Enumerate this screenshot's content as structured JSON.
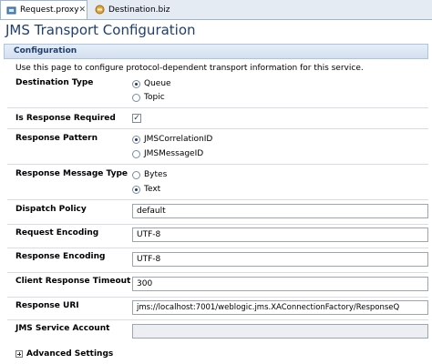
{
  "tabs": [
    {
      "label": "Request.proxy",
      "close": "✕"
    },
    {
      "label": "Destination.biz"
    }
  ],
  "page_title": "JMS Transport Configuration",
  "section_header": "Configuration",
  "description": "Use this page to configure protocol-dependent transport information for this service.",
  "labels": {
    "destination_type": "Destination Type",
    "is_response_required": "Is Response Required",
    "response_pattern": "Response Pattern",
    "response_message_type": "Response Message Type",
    "dispatch_policy": "Dispatch Policy",
    "request_encoding": "Request Encoding",
    "response_encoding": "Response Encoding",
    "client_response_timeout": "Client Response Timeout",
    "response_uri": "Response URI",
    "jms_service_account": "JMS Service Account"
  },
  "destination_type_options": [
    {
      "label": "Queue",
      "selected": true
    },
    {
      "label": "Topic",
      "selected": false
    }
  ],
  "is_response_required": true,
  "response_pattern_options": [
    {
      "label": "JMSCorrelationID",
      "selected": true
    },
    {
      "label": "JMSMessageID",
      "selected": false
    }
  ],
  "response_message_type_options": [
    {
      "label": "Bytes",
      "selected": false
    },
    {
      "label": "Text",
      "selected": true
    }
  ],
  "values": {
    "dispatch_policy": "default",
    "request_encoding": "UTF-8",
    "response_encoding": "UTF-8",
    "client_response_timeout": "300",
    "response_uri": "jms://localhost:7001/weblogic.jms.XAConnectionFactory/ResponseQ",
    "jms_service_account": ""
  },
  "advanced_settings": "Advanced Settings",
  "colors": {
    "accent": "#1f3f6e",
    "tab_bar": "#e4ebf3",
    "section_header": "#d3e0f0"
  }
}
